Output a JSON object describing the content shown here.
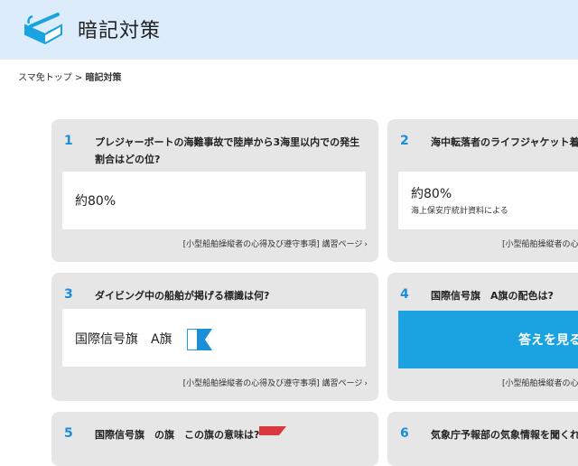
{
  "header": {
    "title": "暗記対策",
    "logo_icon": "book-pen-icon"
  },
  "breadcrumb": {
    "home": "スマ免トップ",
    "separator": " > ",
    "current": "暗記対策"
  },
  "cards": [
    {
      "number": "1",
      "question": "プレジャーボートの海難事故で陸岸から3海里以内での発生割合はどの位?",
      "answer": "約80%",
      "link": "[小型船舶操縦者の心得及び遵守事項] 講習ページ"
    },
    {
      "number": "2",
      "question": "海中転落者のライフジャケット着",
      "answer": "約80%",
      "answer_note": "海上保安庁統計資料による",
      "link": "[小型船舶操縦者の心"
    },
    {
      "number": "3",
      "question": "ダイビング中の船舶が掲げる標識は何?",
      "answer": "国際信号旗　A旗",
      "link": "[小型船舶操縦者の心得及び遵守事項] 講習ページ"
    },
    {
      "number": "4",
      "question": "国際信号旗　A旗の配色は?",
      "reveal_button": "答えを見る",
      "link": "[小型船舶操縦者の心"
    },
    {
      "number": "5",
      "question": "国際信号旗　の旗　この旗の意味は?"
    },
    {
      "number": "6",
      "question": "気象庁予報部の気象情報を聞くれ"
    }
  ],
  "colors": {
    "accent": "#1a8fd8",
    "button": "#1aa3e0",
    "header_bg": "#dcecfb",
    "card_bg": "#e6e6e6"
  }
}
